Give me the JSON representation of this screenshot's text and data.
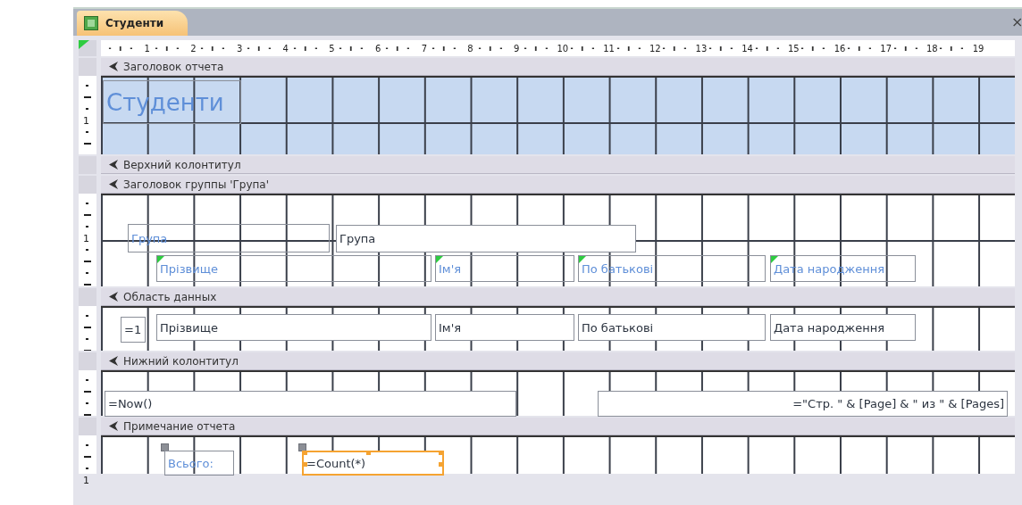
{
  "tab": {
    "title": "Студенти",
    "selected": true
  },
  "close": "×",
  "ruler": [
    "1",
    "2",
    "3",
    "4",
    "5",
    "6",
    "7",
    "8",
    "9",
    "10",
    "11",
    "12",
    "13",
    "14",
    "15",
    "16",
    "17",
    "18",
    "19"
  ],
  "sections": [
    {
      "kind": "report_header",
      "title": "Заголовок отчета",
      "side_label": "1",
      "tinted": true,
      "controls": [
        {
          "kind": "label",
          "text": "Студенти",
          "selected": false,
          "error_marker": false
        }
      ]
    },
    {
      "kind": "page_header",
      "title": "Верхний колонтитул"
    },
    {
      "kind": "group_header",
      "title": "Заголовок группы 'Група'",
      "side_label": "1",
      "tinted": false,
      "controls": [
        {
          "kind": "label",
          "text": "Група",
          "selected": false,
          "error_marker": false
        },
        {
          "kind": "textbox",
          "text": "Група",
          "selected": false,
          "error_marker": false
        },
        {
          "kind": "label",
          "text": "Прізвище",
          "selected": false,
          "error_marker": true
        },
        {
          "kind": "label",
          "text": "Ім'я",
          "selected": false,
          "error_marker": true
        },
        {
          "kind": "label",
          "text": "По батькові",
          "selected": false,
          "error_marker": true
        },
        {
          "kind": "label",
          "text": "Дата народження",
          "selected": false,
          "error_marker": true
        }
      ]
    },
    {
      "kind": "detail",
      "title": "Область данных",
      "tinted": false,
      "controls": [
        {
          "kind": "textbox",
          "text": "=1",
          "selected": false,
          "error_marker": false
        },
        {
          "kind": "textbox",
          "text": "Прізвище",
          "selected": false,
          "error_marker": false
        },
        {
          "kind": "textbox",
          "text": "Ім'я",
          "selected": false,
          "error_marker": false
        },
        {
          "kind": "textbox",
          "text": "По батькові",
          "selected": false,
          "error_marker": false
        },
        {
          "kind": "textbox",
          "text": "Дата народження",
          "selected": false,
          "error_marker": false
        }
      ]
    },
    {
      "kind": "page_footer",
      "title": "Нижний колонтитул",
      "tinted": false,
      "controls": [
        {
          "kind": "textbox",
          "text": "=Now()",
          "selected": false,
          "error_marker": false
        },
        {
          "kind": "textbox",
          "text": "=\"Стр. \" & [Page] & \" из \" & [Pages]",
          "selected": false,
          "error_marker": false
        }
      ]
    },
    {
      "kind": "report_footer",
      "title": "Примечание отчета",
      "side_label": "1",
      "tinted": false,
      "controls": [
        {
          "kind": "label",
          "text": "Всього:",
          "selected": false,
          "error_marker": false
        },
        {
          "kind": "textbox",
          "text": "=Count(*)",
          "selected": true,
          "error_marker": false
        }
      ]
    }
  ]
}
